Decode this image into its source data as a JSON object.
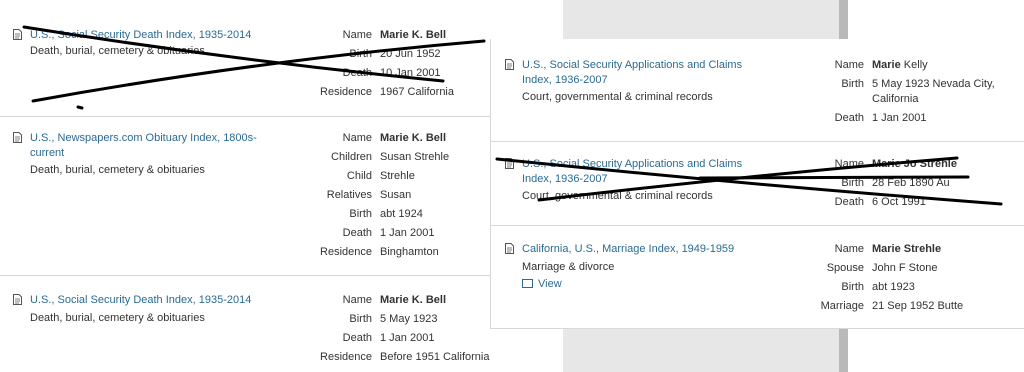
{
  "left_column": {
    "records": [
      {
        "title": "U.S., Social Security Death Index, 1935-2014",
        "category": "Death, burial, cemetery & obituaries",
        "crossed_out": true,
        "fields": [
          {
            "label": "Name",
            "value": "Marie K. Bell",
            "bold": true
          },
          {
            "label": "Birth",
            "value": "20 Jun 1952"
          },
          {
            "label": "Death",
            "value": "10 Jan 2001"
          },
          {
            "label": "Residence",
            "value": "1967 California"
          }
        ]
      },
      {
        "title_line1": "U.S., Newspapers.com Obituary Index, 1800s-",
        "title_line2": "current",
        "category": "Death, burial, cemetery & obituaries",
        "fields": [
          {
            "label": "Name",
            "value": "Marie K. Bell",
            "bold": true
          },
          {
            "label": "Children",
            "value": "Susan Strehle"
          },
          {
            "label": "Child",
            "value": "Strehle"
          },
          {
            "label": "Relatives",
            "value": "Susan"
          },
          {
            "label": "Birth",
            "value": "abt 1924"
          },
          {
            "label": "Death",
            "value": "1 Jan 2001"
          },
          {
            "label": "Residence",
            "value": "Binghamton"
          }
        ]
      },
      {
        "title": "U.S., Social Security Death Index, 1935-2014",
        "category": "Death, burial, cemetery & obituaries",
        "fields": [
          {
            "label": "Name",
            "value": "Marie K. Bell",
            "bold": true
          },
          {
            "label": "Birth",
            "value": "5 May 1923"
          },
          {
            "label": "Death",
            "value": "1 Jan 2001"
          },
          {
            "label": "Residence",
            "value": "Before 1951 California"
          }
        ]
      }
    ]
  },
  "right_column": {
    "records": [
      {
        "title_line1": "U.S., Social Security Applications and Claims",
        "title_line2": "Index, 1936-2007",
        "category": "Court, governmental & criminal records",
        "fields": [
          {
            "label": "Name",
            "value_bold": "Marie",
            "value_rest": " Kelly"
          },
          {
            "label": "Birth",
            "value": "5 May 1923 Nevada City,",
            "value_line2": "California"
          },
          {
            "label": "Death",
            "value": "1 Jan 2001"
          }
        ]
      },
      {
        "title_line1": "U.S., Social Security Applications and Claims",
        "title_line2": "Index, 1936-2007",
        "category": "Court, governmental & criminal records",
        "crossed_out": true,
        "fields": [
          {
            "label": "Name",
            "value_bold": "Marie Jo Strehle"
          },
          {
            "label": "Birth",
            "value": "28 Feb 1890 Au"
          },
          {
            "label": "Death",
            "value": "6 Oct 1991"
          }
        ]
      },
      {
        "title": "California, U.S., Marriage Index, 1949-1959",
        "category": "Marriage & divorce",
        "view_label": "View",
        "fields": [
          {
            "label": "Name",
            "value": "Marie Strehle",
            "bold": true
          },
          {
            "label": "Spouse",
            "value": "John F Stone"
          },
          {
            "label": "Birth",
            "value": "abt 1923"
          },
          {
            "label": "Marriage",
            "value": "21 Sep 1952 Butte"
          }
        ]
      }
    ]
  },
  "icons": {
    "record": "document-icon",
    "view": "image-icon"
  },
  "colors": {
    "link": "#2a6b93",
    "text": "#333333",
    "divider": "#d8d8d8",
    "side_gray": "#e7e7e7",
    "cross_marks": "#000000"
  }
}
